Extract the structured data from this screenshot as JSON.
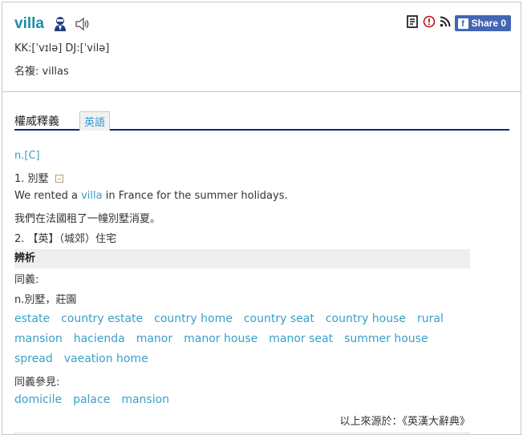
{
  "header": {
    "word": "villa",
    "pronunciation": "KK:[ˈvɪlə] DJ:[ˈvilə]",
    "forms": "名複: villas",
    "share_label": "Share 0",
    "fb_letter": "f"
  },
  "tabs": {
    "title": "權威釋義",
    "english": "英語"
  },
  "definition": {
    "pos": "n.[C]",
    "sense1": "1. 別墅",
    "example_prefix": "We rented a ",
    "example_word": "villa",
    "example_suffix": " in France for the summer holidays.",
    "example_translation": "我們在法國租了一幢別墅消夏。",
    "sense2": "2. 【英】（城郊）住宅"
  },
  "analysis": {
    "heading": "辨析",
    "synonyms_label": "同義:",
    "synonyms_sense": "n.別墅，莊園",
    "synonyms": [
      "estate",
      "country estate",
      "country home",
      "country seat",
      "country house",
      "rural mansion",
      "hacienda",
      "manor",
      "manor house",
      "manor seat",
      "summer house",
      "spread",
      "vaeation home"
    ],
    "see_also_label": "同義參見:",
    "see_also": [
      "domicile",
      "palace",
      "mansion"
    ]
  },
  "source": "以上來源於：《英漢大辭典》",
  "colors": {
    "accent": "#1e8aa8",
    "link": "#3aa0c6",
    "underline": "#0b2a6e",
    "facebook": "#4267b2"
  },
  "icons": [
    "person-icon",
    "speaker-icon",
    "vocabulary-book-icon",
    "report-icon",
    "rss-icon",
    "facebook-icon"
  ]
}
